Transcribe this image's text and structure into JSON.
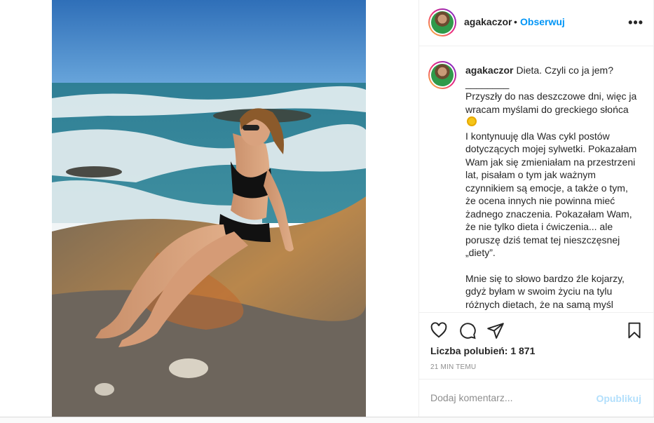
{
  "post": {
    "username": "agakaczor",
    "dot": "•",
    "follow_label": "Obserwuj",
    "more_label": "•••"
  },
  "caption": {
    "username": "agakaczor",
    "lines": [
      "Dieta. Czyli co ja jem?",
      "________",
      "Przyszły do nas deszczowe dni, więc ja wracam myślami do greckiego słońca",
      "I kontynuuję dla Was cykl postów dotyczących mojej sylwetki. Pokazałam Wam jak się zmieniałam na przestrzeni lat, pisałam o tym jak ważnym czynnikiem są emocje, a także o tym, że ocena innych nie powinna mieć żadnego znaczenia. Pokazałam Wam, że nie tylko dieta i ćwiczenia... ale poruszę dziś temat tej nieszczęsnej „diety”.",
      "",
      "Mnie się to słowo bardzo źle kojarzy, gdyż byłam w swoim życiu na tylu różnych dietach, że na samą myśl"
    ],
    "emoji": "sun-emoji"
  },
  "actions": {
    "like_icon": "heart-icon",
    "comment_icon": "comment-icon",
    "share_icon": "send-icon",
    "save_icon": "bookmark-icon",
    "likes_label": "Liczba polubień:",
    "likes_count": "1 871",
    "time_ago": "21 MIN TEMU"
  },
  "comment": {
    "placeholder": "Dodaj komentarz...",
    "publish_label": "Opublikuj"
  },
  "colors": {
    "accent": "#0095f6",
    "publish_disabled": "#b2dffc",
    "muted": "#8e8e8e",
    "text": "#262626"
  }
}
